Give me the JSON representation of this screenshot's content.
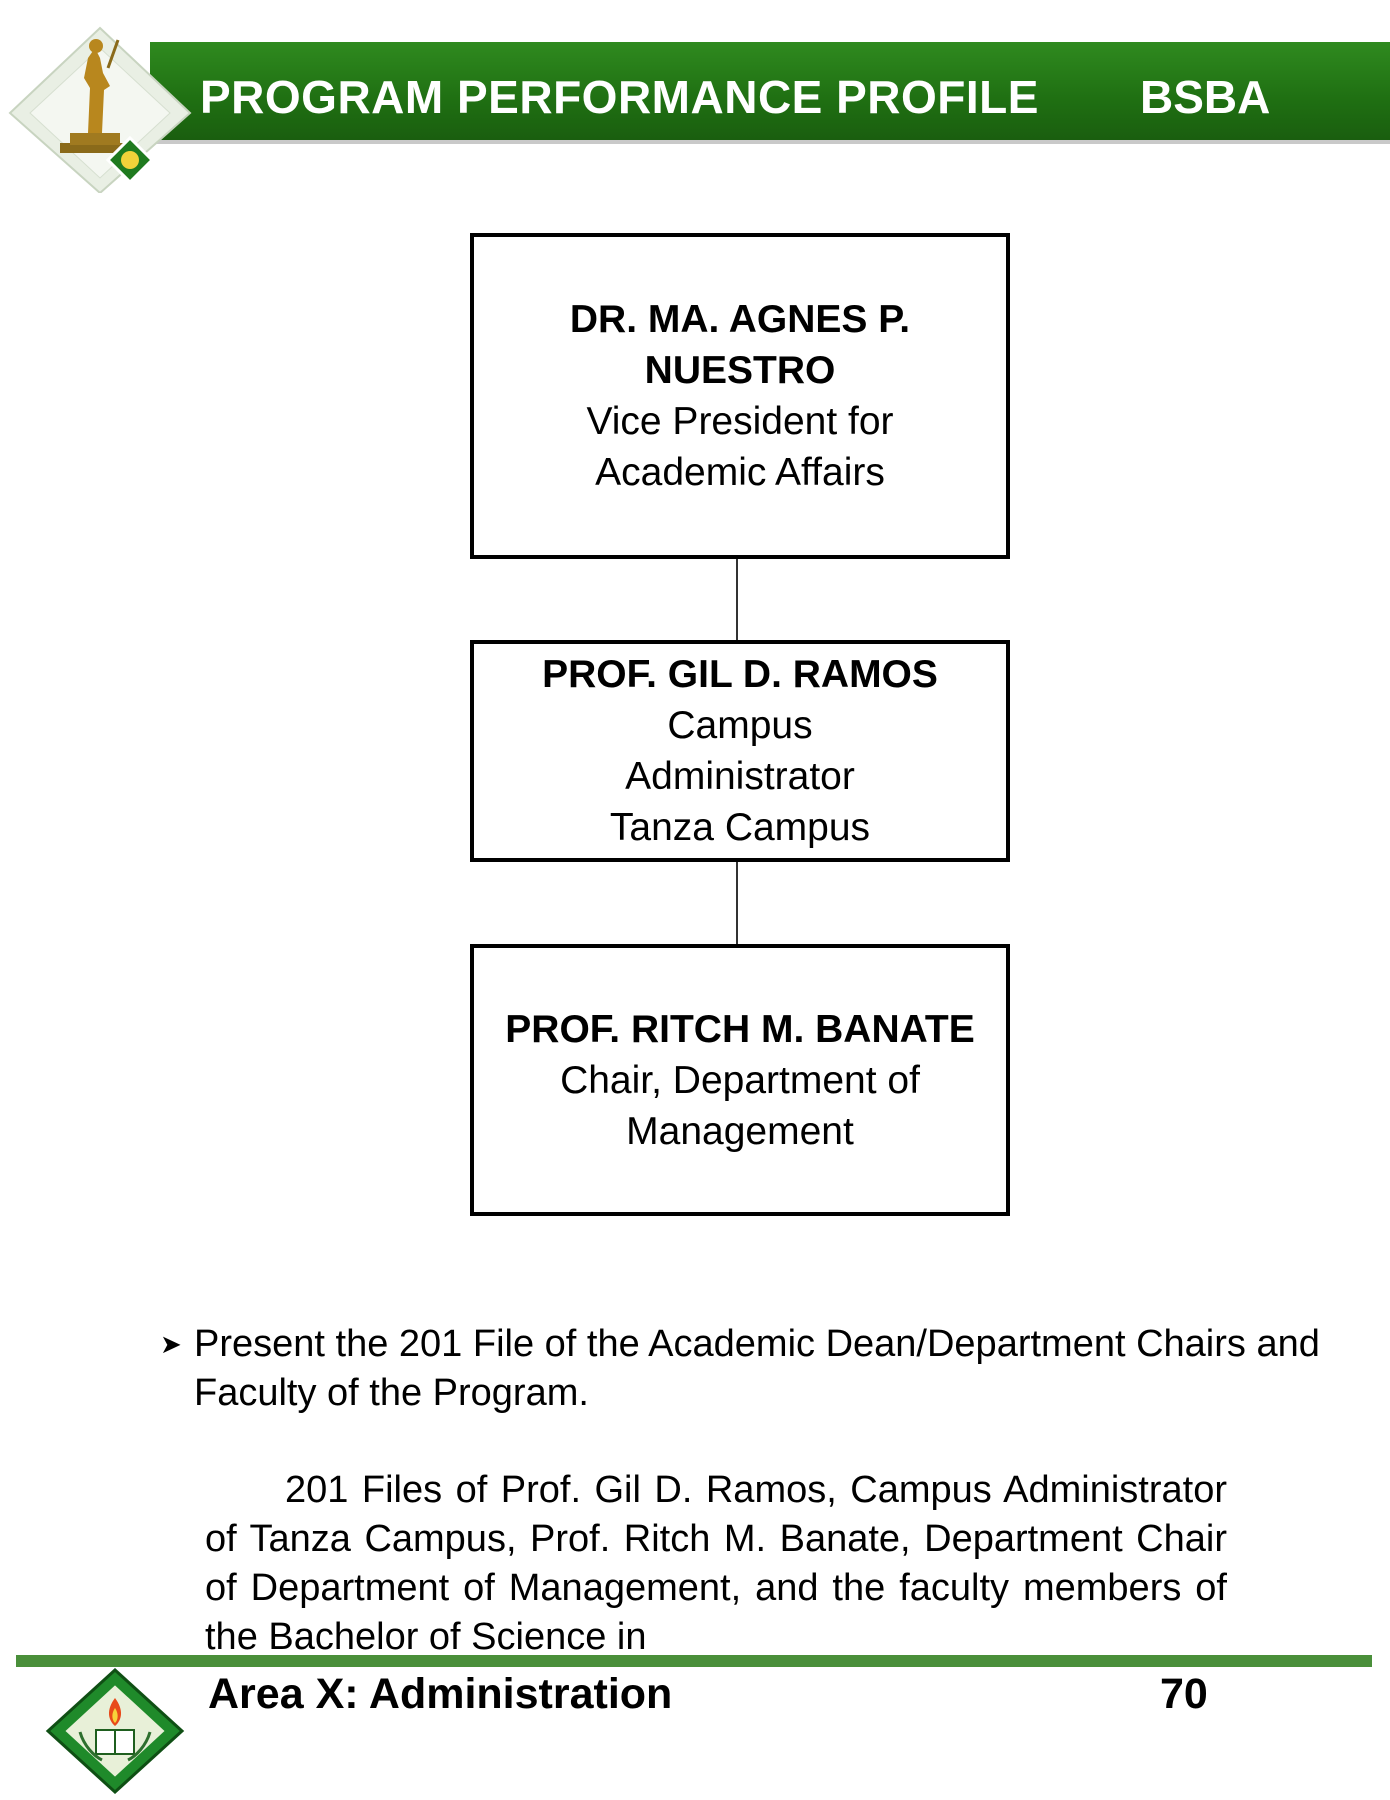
{
  "header": {
    "title": "PROGRAM PERFORMANCE PROFILE",
    "program": "BSBA"
  },
  "org_chart": [
    {
      "name_lines": [
        "DR. MA. AGNES P.",
        "NUESTRO"
      ],
      "role_lines": [
        "Vice President for",
        "Academic Affairs"
      ]
    },
    {
      "name_lines": [
        "PROF. GIL D. RAMOS"
      ],
      "role_lines": [
        "Campus",
        "Administrator",
        "Tanza Campus"
      ]
    },
    {
      "name_lines": [
        "PROF. RITCH M. BANATE"
      ],
      "role_lines": [
        "Chair, Department of",
        "Management"
      ]
    }
  ],
  "bullet": {
    "text": "Present the 201 File of the Academic Dean/Department Chairs and Faculty of the Program."
  },
  "paragraph": "201 Files of Prof. Gil D. Ramos, Campus Administrator of Tanza Campus, Prof. Ritch M. Banate, Department Chair of Department of Management, and the faculty members of the Bachelor of Science in",
  "footer": {
    "area": "Area X: Administration",
    "page": "70"
  },
  "colors": {
    "header_green": "#1f6f12",
    "footer_line": "#4a8f3a"
  }
}
